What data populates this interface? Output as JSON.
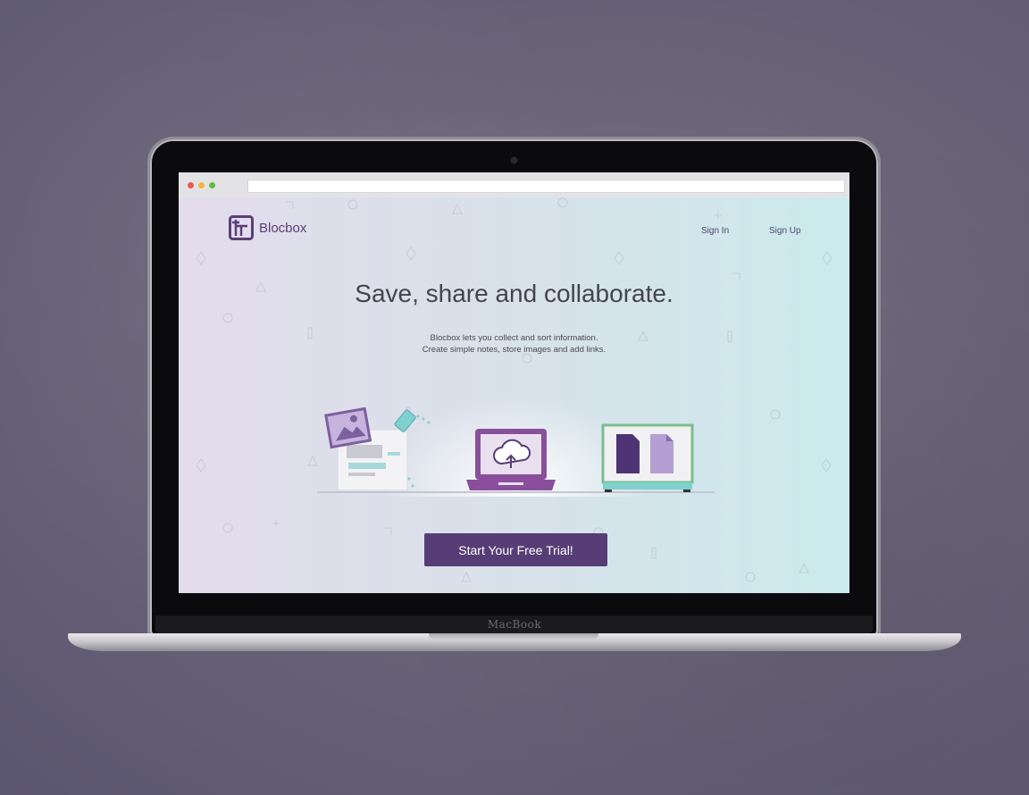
{
  "device": {
    "brand": "MacBook"
  },
  "browser": {
    "dots": [
      {
        "name": "close",
        "color": "#f0584f"
      },
      {
        "name": "minimize",
        "color": "#f6b63b"
      },
      {
        "name": "maximize",
        "color": "#5dc040"
      }
    ]
  },
  "page": {
    "logo": {
      "text": "Blocbox",
      "icon": "blocbox-logo-icon",
      "color": "#5a3e78"
    },
    "nav": {
      "sign_in": "Sign In",
      "sign_up": "Sign Up"
    },
    "hero": {
      "title": "Save, share and collaborate.",
      "subtitle_line1": "Blocbox lets you collect and sort information.",
      "subtitle_line2": "Create simple notes, store images and add links."
    },
    "cta": {
      "label": "Start Your Free Trial!",
      "color": "#573d76"
    },
    "illustrations": [
      "notes-images-icon",
      "cloud-upload-laptop-icon",
      "documents-monitor-icon"
    ]
  }
}
